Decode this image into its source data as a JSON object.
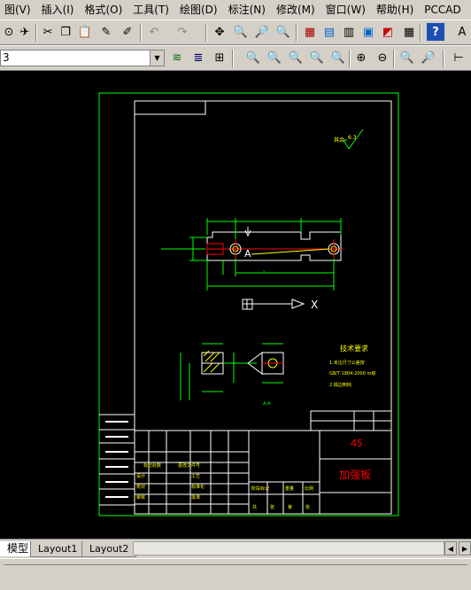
{
  "menu": [
    "图(V)",
    "插入(I)",
    "格式(O)",
    "工具(T)",
    "绘图(D)",
    "标注(N)",
    "修改(M)",
    "窗口(W)",
    "帮助(H)",
    "PCCAD"
  ],
  "layer_combo": {
    "value": "3"
  },
  "tabs": {
    "model": "模型",
    "layout1": "Layout1",
    "layout2": "Layout2"
  },
  "drawing": {
    "roughness": "6.3",
    "roughness_prefix": "其余",
    "tech_title": "技术要求",
    "tech_lines": [
      "1.未注尺寸公差按",
      "GB/T 1804-2000 m级",
      "2.锐边倒钝"
    ],
    "material": "45",
    "part_name": "加强板",
    "scale_label": "比例",
    "sheet_labels": [
      "共",
      "张",
      "第",
      "张"
    ],
    "title_small_labels": [
      "标记",
      "处数",
      "分区",
      "更改文件号",
      "签名",
      "年月日"
    ],
    "role_labels": [
      "设计",
      "校对",
      "审核",
      "工艺",
      "标准化",
      "批准"
    ],
    "stage_labels": [
      "阶段标记",
      "重量",
      "比例"
    ],
    "label_a": "A",
    "label_x": "X",
    "sec_label": "A-A"
  },
  "colors": {
    "drawing_bg": "#000000",
    "frame": "#00ff00",
    "paper": "#ffffff",
    "dim": "#00ff00",
    "center": "#ff0000",
    "text": "#ffff00"
  }
}
